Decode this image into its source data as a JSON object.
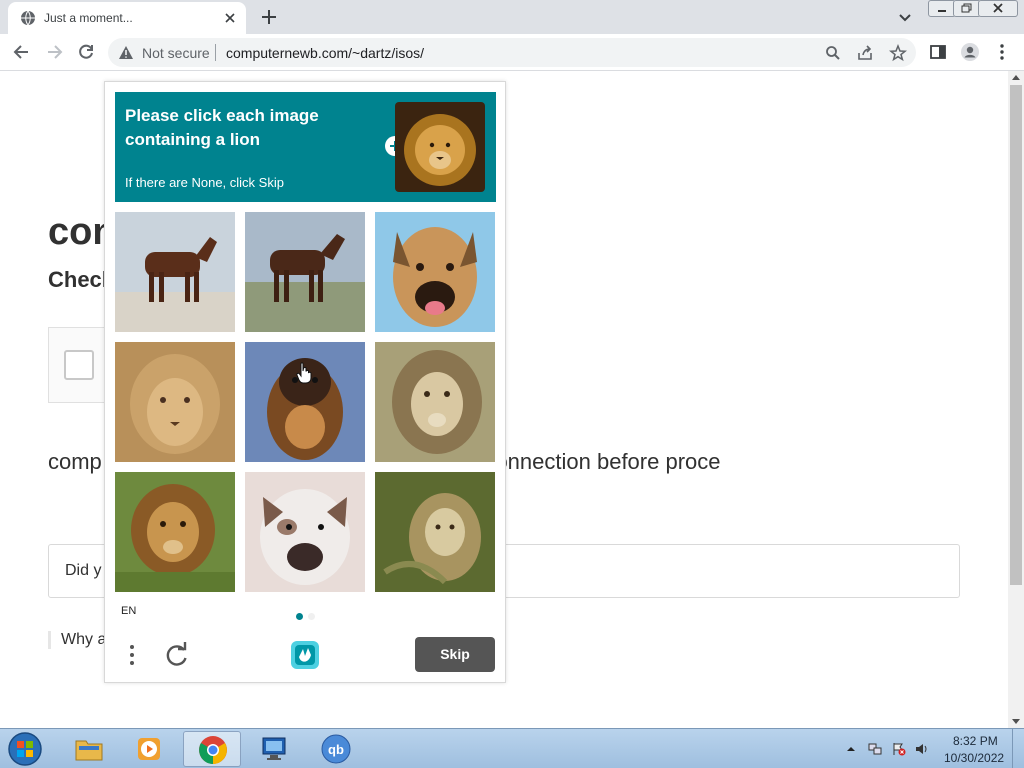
{
  "browser": {
    "tab_title": "Just a moment...",
    "security_label": "Not secure",
    "url": "computernewb.com/~dartz/isos/"
  },
  "page": {
    "heading_fragment": "con",
    "subheading_fragment": "Check",
    "paragraph": "comp                                         curity of your connection before proce",
    "details_fragment": "Did y",
    "why_fragment": "Why a"
  },
  "captcha": {
    "prompt_title": "Please click each image containing a lion",
    "prompt_subtitle": "If there are None, click Skip",
    "language": "EN",
    "skip_label": "Skip",
    "accent_color": "#00838f",
    "grid": [
      {
        "subject": "horse"
      },
      {
        "subject": "horse"
      },
      {
        "subject": "dog"
      },
      {
        "subject": "lion"
      },
      {
        "subject": "dog"
      },
      {
        "subject": "lion"
      },
      {
        "subject": "lion"
      },
      {
        "subject": "bulldog"
      },
      {
        "subject": "lion"
      }
    ]
  },
  "taskbar": {
    "apps": [
      "explorer",
      "media-player",
      "chrome",
      "remote-desktop",
      "qbittorrent"
    ],
    "clock_time": "8:32 PM",
    "clock_date": "10/30/2022"
  }
}
